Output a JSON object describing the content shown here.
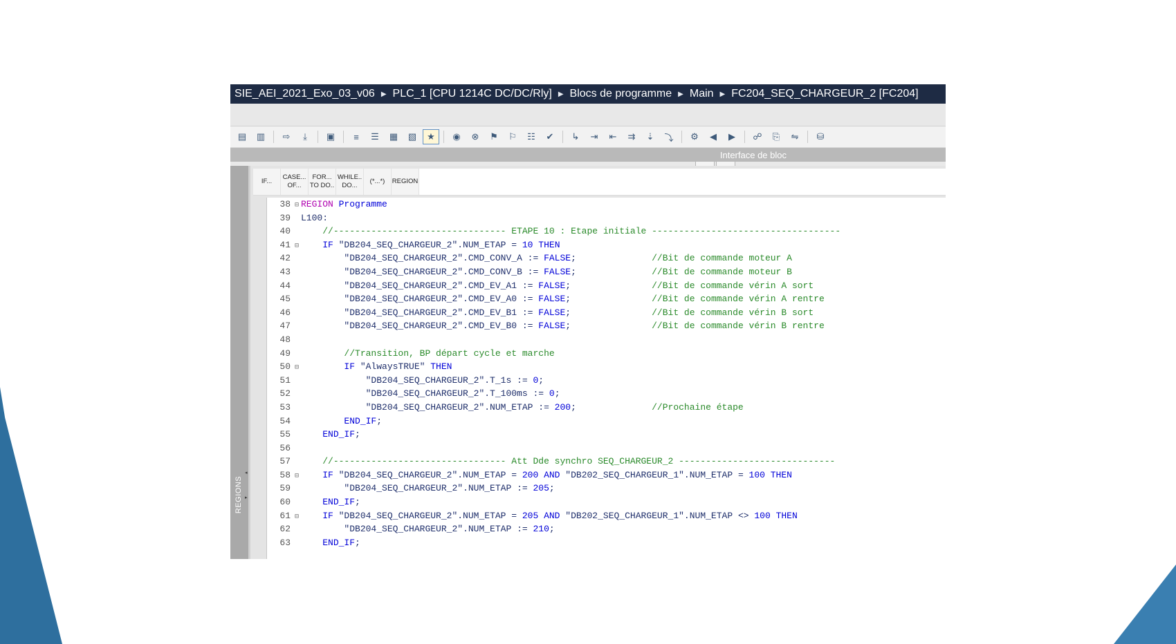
{
  "breadcrumb": [
    "SIE_AEI_2021_Exo_03_v06",
    "PLC_1 [CPU 1214C DC/DC/Rly]",
    "Blocs de programme",
    "Main",
    "FC204_SEQ_CHARGEUR_2 [FC204]"
  ],
  "interface_bar": {
    "label": "Interface de bloc"
  },
  "toolbar_icons": [
    "insert-network-icon",
    "delete-network-icon",
    "compile-icon",
    "download-icon",
    "monitor-icon",
    "indent-icon",
    "outdent-icon",
    "comment-icon",
    "uncomment-icon",
    "favorites-icon",
    "breakpoint-icon",
    "delete-breakpoint-icon",
    "bookmark-icon",
    "next-bookmark-icon",
    "list-icon",
    "check-icon",
    "goto-icon",
    "step-into-icon",
    "step-out-icon",
    "step-over-icon",
    "run-to-icon",
    "line-icon",
    "call-hierarchy-icon",
    "prev-icon",
    "next-icon",
    "monitoring-on-icon",
    "snapshot-icon",
    "compare-icon",
    "db-icon"
  ],
  "snippets": [
    "IF...",
    "CASE...\nOF...",
    "FOR...\nTO DO..",
    "WHILE..\nDO...",
    "(*...*)",
    "REGION"
  ],
  "regions_label": "REGIONS",
  "code_lines": [
    {
      "n": "38",
      "fold": true,
      "indent": 0,
      "parts": [
        [
          "m",
          "REGION"
        ],
        [
          "t",
          " Programme"
        ]
      ]
    },
    {
      "n": "39",
      "fold": false,
      "indent": 0,
      "parts": [
        [
          "o",
          "L100:"
        ]
      ]
    },
    {
      "n": "40",
      "fold": false,
      "indent": 4,
      "parts": [
        [
          "g",
          "//-------------------------------- ETAPE 10 : Etape initiale -----------------------------------"
        ]
      ]
    },
    {
      "n": "41",
      "fold": true,
      "indent": 4,
      "parts": [
        [
          "k",
          "IF"
        ],
        [
          "o",
          " \"DB204_SEQ_CHARGEUR_2\".NUM_ETAP = "
        ],
        [
          "t",
          "10"
        ],
        [
          "k",
          " THEN"
        ]
      ]
    },
    {
      "n": "42",
      "fold": false,
      "indent": 8,
      "parts": [
        [
          "o",
          "\"DB204_SEQ_CHARGEUR_2\".CMD_CONV_A := "
        ],
        [
          "k",
          "FALSE"
        ],
        [
          "o",
          ";              "
        ],
        [
          "g",
          "//Bit de commande moteur A"
        ]
      ]
    },
    {
      "n": "43",
      "fold": false,
      "indent": 8,
      "parts": [
        [
          "o",
          "\"DB204_SEQ_CHARGEUR_2\".CMD_CONV_B := "
        ],
        [
          "k",
          "FALSE"
        ],
        [
          "o",
          ";              "
        ],
        [
          "g",
          "//Bit de commande moteur B"
        ]
      ]
    },
    {
      "n": "44",
      "fold": false,
      "indent": 8,
      "parts": [
        [
          "o",
          "\"DB204_SEQ_CHARGEUR_2\".CMD_EV_A1 := "
        ],
        [
          "k",
          "FALSE"
        ],
        [
          "o",
          ";               "
        ],
        [
          "g",
          "//Bit de commande vérin A sort"
        ]
      ]
    },
    {
      "n": "45",
      "fold": false,
      "indent": 8,
      "parts": [
        [
          "o",
          "\"DB204_SEQ_CHARGEUR_2\".CMD_EV_A0 := "
        ],
        [
          "k",
          "FALSE"
        ],
        [
          "o",
          ";               "
        ],
        [
          "g",
          "//Bit de commande vérin A rentre"
        ]
      ]
    },
    {
      "n": "46",
      "fold": false,
      "indent": 8,
      "parts": [
        [
          "o",
          "\"DB204_SEQ_CHARGEUR_2\".CMD_EV_B1 := "
        ],
        [
          "k",
          "FALSE"
        ],
        [
          "o",
          ";               "
        ],
        [
          "g",
          "//Bit de commande vérin B sort"
        ]
      ]
    },
    {
      "n": "47",
      "fold": false,
      "indent": 8,
      "parts": [
        [
          "o",
          "\"DB204_SEQ_CHARGEUR_2\".CMD_EV_B0 := "
        ],
        [
          "k",
          "FALSE"
        ],
        [
          "o",
          ";               "
        ],
        [
          "g",
          "//Bit de commande vérin B rentre"
        ]
      ]
    },
    {
      "n": "48",
      "fold": false,
      "indent": 0,
      "parts": []
    },
    {
      "n": "49",
      "fold": false,
      "indent": 8,
      "parts": [
        [
          "g",
          "//Transition, BP départ cycle et marche"
        ]
      ]
    },
    {
      "n": "50",
      "fold": true,
      "indent": 8,
      "parts": [
        [
          "k",
          "IF"
        ],
        [
          "o",
          " \"AlwaysTRUE\""
        ],
        [
          "k",
          " THEN"
        ]
      ]
    },
    {
      "n": "51",
      "fold": false,
      "indent": 12,
      "parts": [
        [
          "o",
          "\"DB204_SEQ_CHARGEUR_2\".T_1s := "
        ],
        [
          "t",
          "0"
        ],
        [
          "o",
          ";"
        ]
      ]
    },
    {
      "n": "52",
      "fold": false,
      "indent": 12,
      "parts": [
        [
          "o",
          "\"DB204_SEQ_CHARGEUR_2\".T_100ms := "
        ],
        [
          "t",
          "0"
        ],
        [
          "o",
          ";"
        ]
      ]
    },
    {
      "n": "53",
      "fold": false,
      "indent": 12,
      "parts": [
        [
          "o",
          "\"DB204_SEQ_CHARGEUR_2\".NUM_ETAP := "
        ],
        [
          "t",
          "200"
        ],
        [
          "o",
          ";              "
        ],
        [
          "g",
          "//Prochaine étape"
        ]
      ]
    },
    {
      "n": "54",
      "fold": false,
      "indent": 8,
      "parts": [
        [
          "k",
          "END_IF"
        ],
        [
          "o",
          ";"
        ]
      ]
    },
    {
      "n": "55",
      "fold": false,
      "indent": 4,
      "parts": [
        [
          "k",
          "END_IF"
        ],
        [
          "o",
          ";"
        ]
      ]
    },
    {
      "n": "56",
      "fold": false,
      "indent": 0,
      "parts": []
    },
    {
      "n": "57",
      "fold": false,
      "indent": 4,
      "parts": [
        [
          "g",
          "//-------------------------------- Att Dde synchro SEQ_CHARGEUR_2 -----------------------------"
        ]
      ]
    },
    {
      "n": "58",
      "fold": true,
      "indent": 4,
      "parts": [
        [
          "k",
          "IF"
        ],
        [
          "o",
          " \"DB204_SEQ_CHARGEUR_2\".NUM_ETAP = "
        ],
        [
          "t",
          "200"
        ],
        [
          "k",
          " AND"
        ],
        [
          "o",
          " \"DB202_SEQ_CHARGEUR_1\".NUM_ETAP = "
        ],
        [
          "t",
          "100"
        ],
        [
          "k",
          " THEN"
        ]
      ]
    },
    {
      "n": "59",
      "fold": false,
      "indent": 8,
      "parts": [
        [
          "o",
          "\"DB204_SEQ_CHARGEUR_2\".NUM_ETAP := "
        ],
        [
          "t",
          "205"
        ],
        [
          "o",
          ";"
        ]
      ]
    },
    {
      "n": "60",
      "fold": false,
      "indent": 4,
      "parts": [
        [
          "k",
          "END_IF"
        ],
        [
          "o",
          ";"
        ]
      ]
    },
    {
      "n": "61",
      "fold": true,
      "indent": 4,
      "parts": [
        [
          "k",
          "IF"
        ],
        [
          "o",
          " \"DB204_SEQ_CHARGEUR_2\".NUM_ETAP = "
        ],
        [
          "t",
          "205"
        ],
        [
          "k",
          " AND"
        ],
        [
          "o",
          " \"DB202_SEQ_CHARGEUR_1\".NUM_ETAP <> "
        ],
        [
          "t",
          "100"
        ],
        [
          "k",
          " THEN"
        ]
      ]
    },
    {
      "n": "62",
      "fold": false,
      "indent": 8,
      "parts": [
        [
          "o",
          "\"DB204_SEQ_CHARGEUR_2\".NUM_ETAP := "
        ],
        [
          "t",
          "210"
        ],
        [
          "o",
          ";"
        ]
      ]
    },
    {
      "n": "63",
      "fold": false,
      "indent": 4,
      "parts": [
        [
          "k",
          "END_IF"
        ],
        [
          "o",
          ";"
        ]
      ]
    }
  ]
}
